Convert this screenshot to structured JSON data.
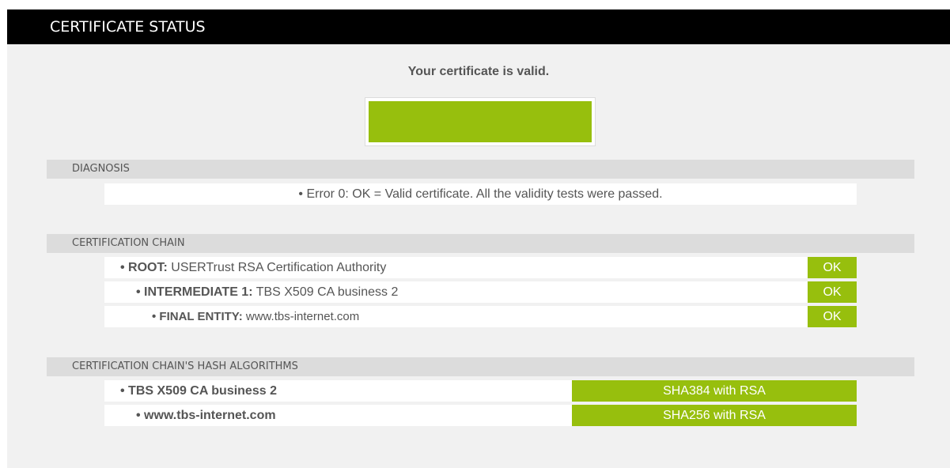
{
  "header": {
    "title": "CERTIFICATE STATUS"
  },
  "status": {
    "message": "Your certificate is valid.",
    "color": "#97bf0d"
  },
  "diagnosis": {
    "title": "DIAGNOSIS",
    "text": "• Error 0: OK = Valid certificate. All the validity tests were passed."
  },
  "chain": {
    "title": "CERTIFICATION CHAIN",
    "items": [
      {
        "label": "• ROOT:",
        "value": " USERTrust RSA Certification Authority",
        "status": "OK"
      },
      {
        "label": "• INTERMEDIATE 1:",
        "value": " TBS X509 CA business 2",
        "status": "OK"
      },
      {
        "label": "• FINAL ENTITY:",
        "value": " www.tbs-internet.com",
        "status": "OK"
      }
    ]
  },
  "hashes": {
    "title": "CERTIFICATION CHAIN'S HASH ALGORITHMS",
    "items": [
      {
        "label": "• TBS X509 CA business 2",
        "algorithm": "SHA384 with RSA"
      },
      {
        "label": "• www.tbs-internet.com",
        "algorithm": "SHA256 with RSA"
      }
    ]
  }
}
